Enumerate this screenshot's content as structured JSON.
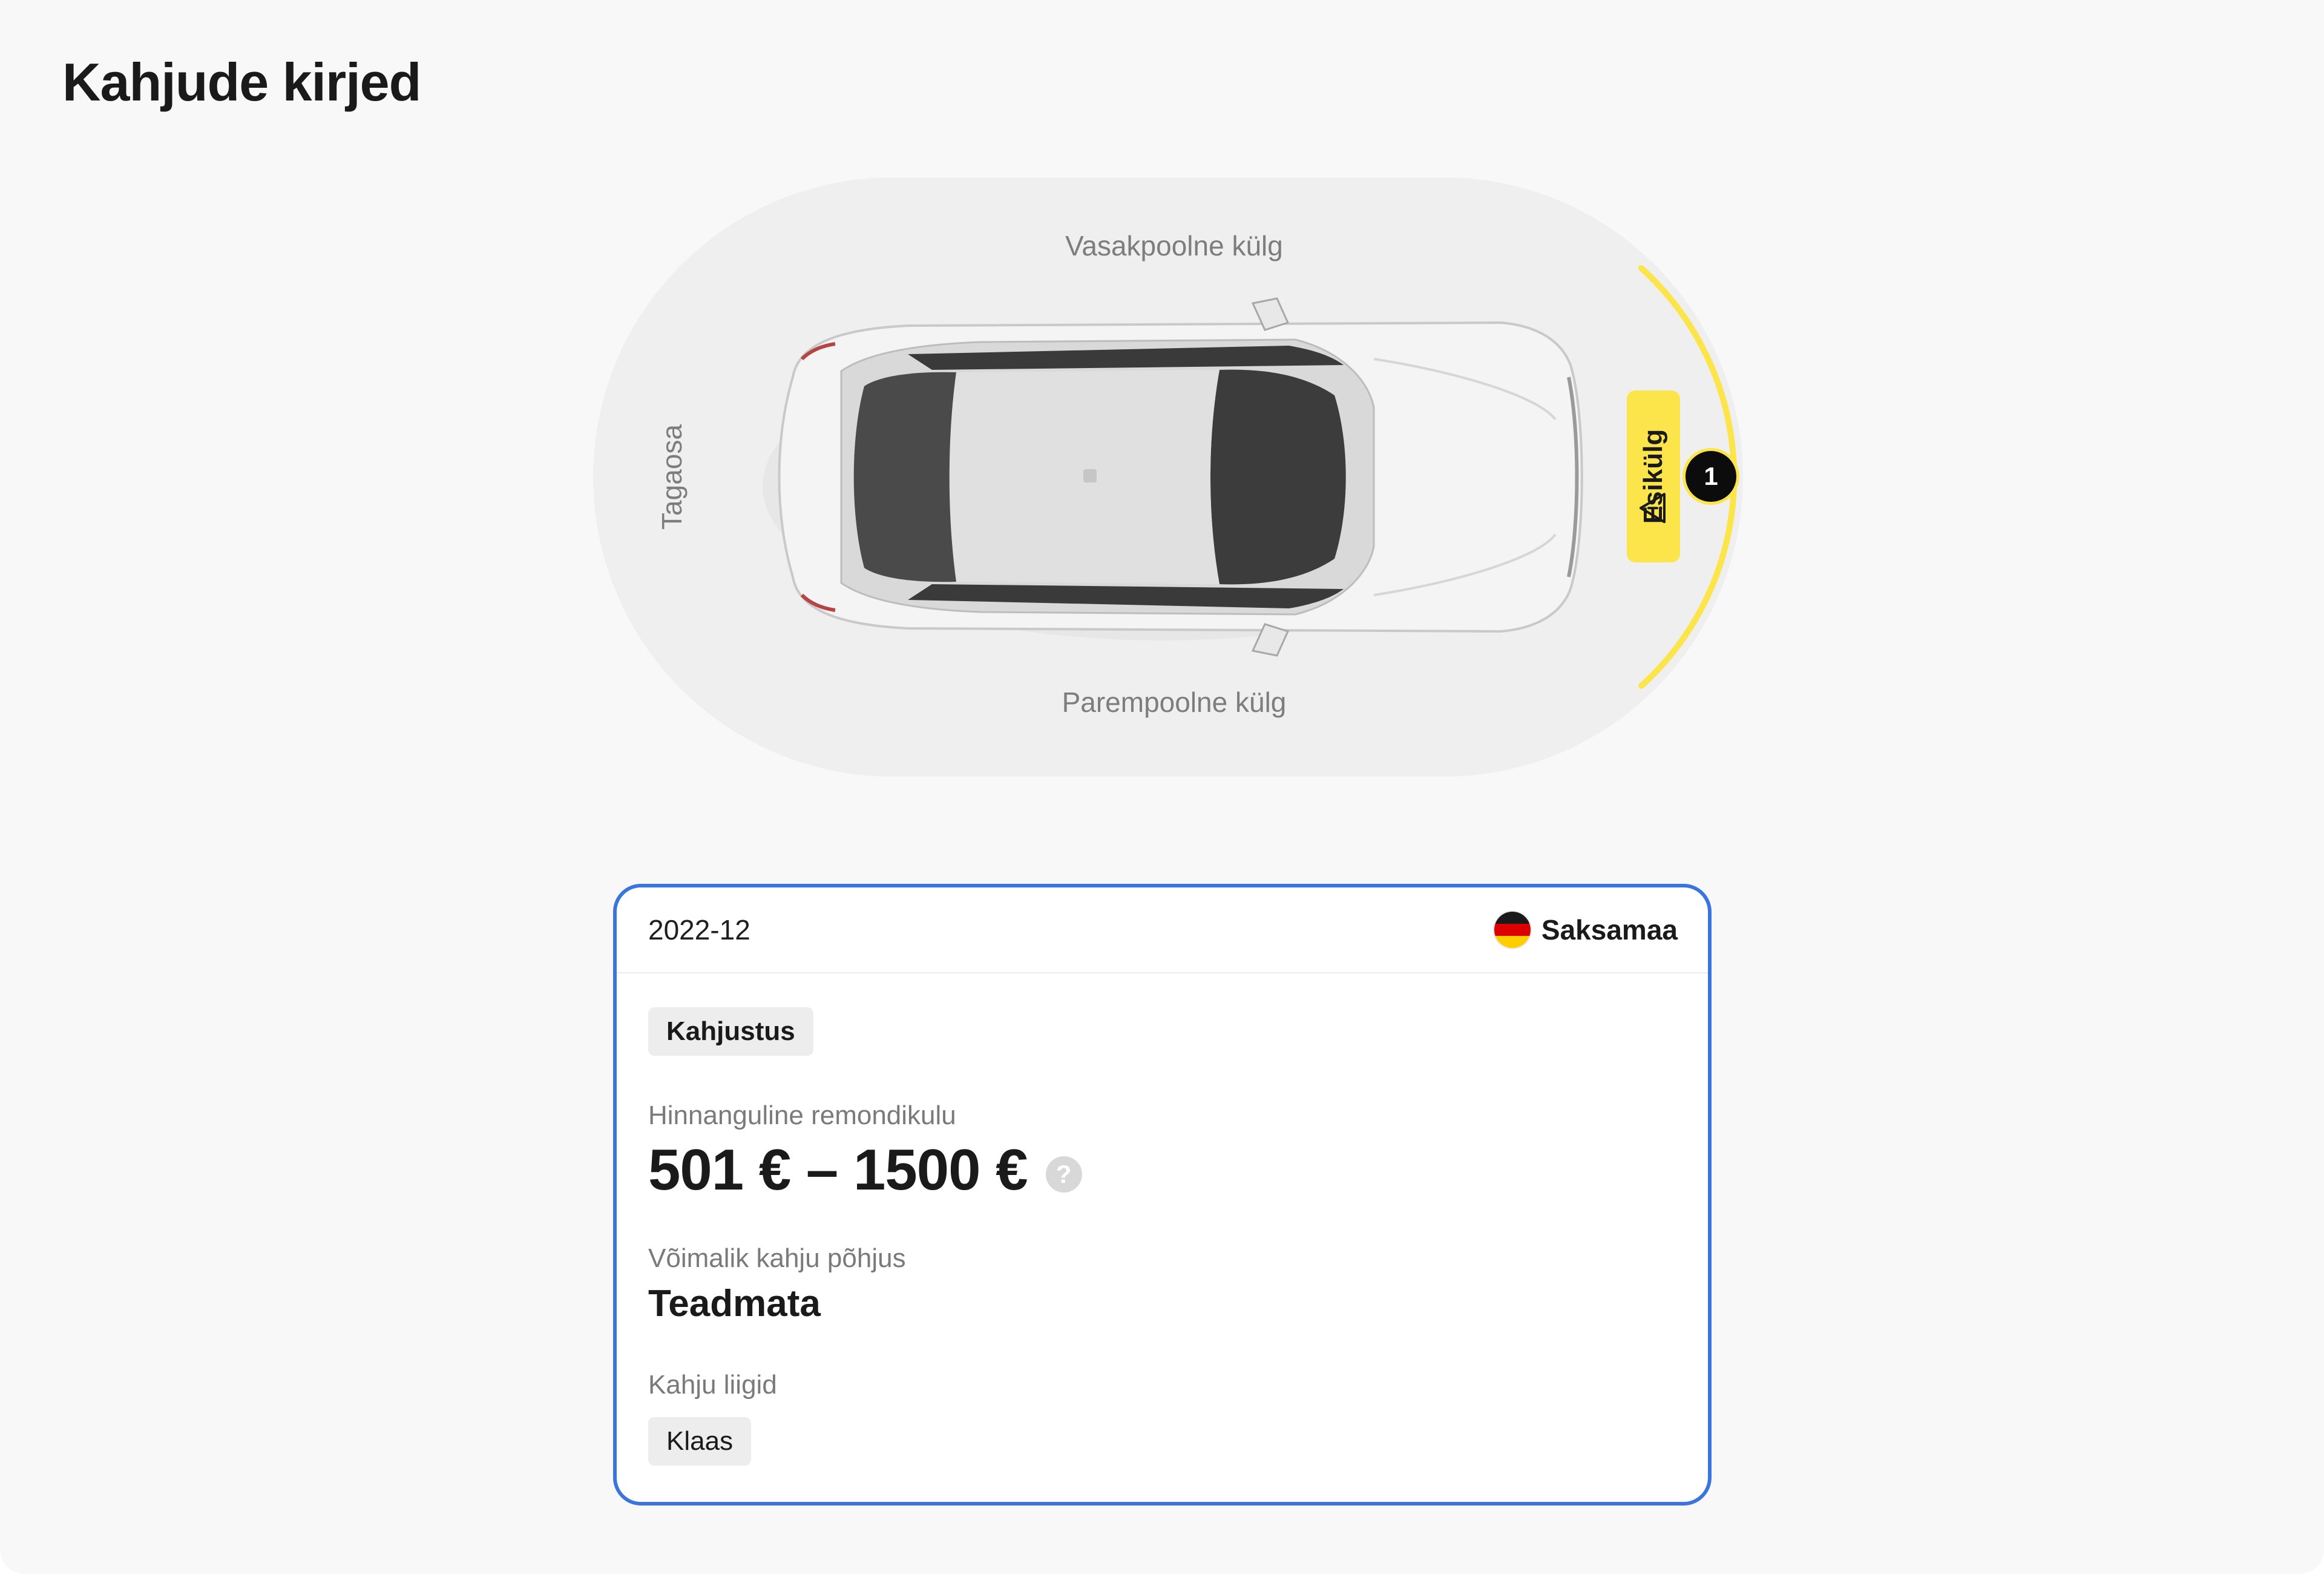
{
  "page": {
    "title": "Kahjude kirjed"
  },
  "diagram": {
    "left_side_label": "Vasakpoolne külg",
    "right_side_label": "Parempoolne külg",
    "rear_label": "Tagaosa",
    "front_label": "Esikülg",
    "front_icon": "warning-triangle-icon",
    "marker_number": "1",
    "colors": {
      "zone_fill": "#efefef",
      "highlight": "#fbe54a",
      "marker": "#0c0c0c"
    }
  },
  "record": {
    "date": "2022-12",
    "country": "Saksamaa",
    "country_flag_colors": [
      "#1a1a1a",
      "#dd0000",
      "#ffce00"
    ],
    "type": "Kahjustus",
    "cost_label": "Hinnanguline remondikulu",
    "cost_value": "501 € – 1500 €",
    "help_icon": "?",
    "cause_label": "Võimalik kahju põhjus",
    "cause_value": "Teadmata",
    "kinds_label": "Kahju liigid",
    "kinds": [
      "Klaas"
    ],
    "accent_color": "#3a74e0"
  }
}
